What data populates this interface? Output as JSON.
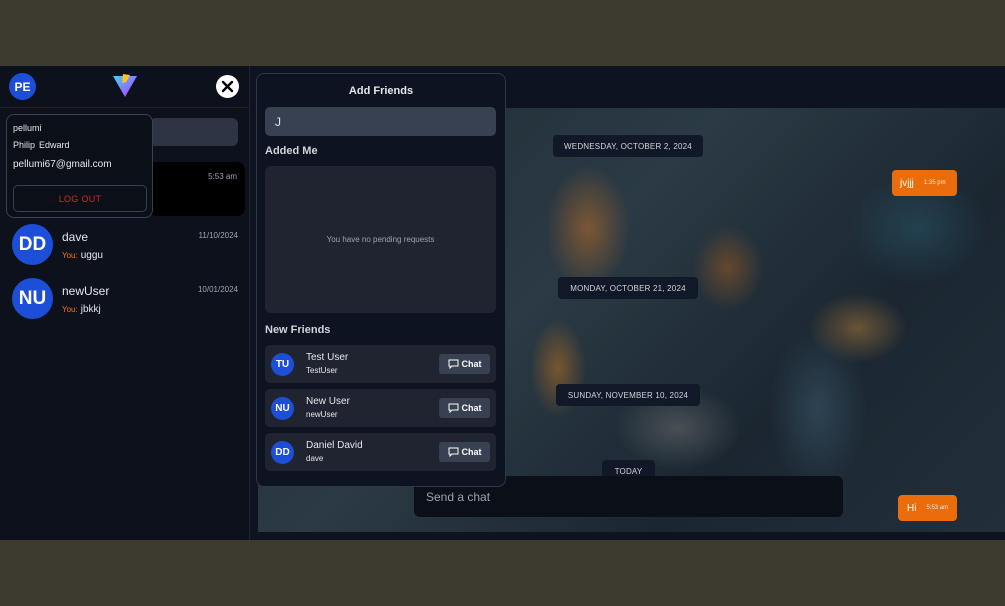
{
  "colors": {
    "accent": "#ea6c0a",
    "avatar": "#1d4ed8",
    "logout": "#dc2626"
  },
  "sidebar": {
    "me_initials": "PE",
    "active_chat_time": "5:53 am",
    "conversations": [
      {
        "initials": "DD",
        "name": "dave",
        "date": "11/10/2024",
        "you_label": "You:",
        "preview": "uggu"
      },
      {
        "initials": "NU",
        "name": "newUser",
        "date": "10/01/2024",
        "you_label": "You:",
        "preview": "jbkkj"
      }
    ]
  },
  "profile": {
    "username": "pellumi",
    "first_name": "Philip",
    "last_name": "Edward",
    "email": "pellumi67@gmail.com",
    "logout_label": "LOG OUT"
  },
  "chat": {
    "dates": [
      "WEDNESDAY, OCTOBER 2, 2024",
      "MONDAY, OCTOBER 21, 2024",
      "SUNDAY, NOVEMBER 10, 2024",
      "TODAY"
    ],
    "messages": [
      {
        "text": "jvjjj",
        "time": "1:35 pm"
      },
      {
        "text": "Hi",
        "time": "5:53 am"
      }
    ],
    "input_placeholder": "Send a chat"
  },
  "add_friends": {
    "title": "Add Friends",
    "search_value": "J",
    "added_me_label": "Added Me",
    "pending_text": "You have no pending requests",
    "new_friends_label": "New Friends",
    "chat_button_label": "Chat",
    "friends": [
      {
        "initials": "TU",
        "name": "Test User",
        "username": "TestUser"
      },
      {
        "initials": "NU",
        "name": "New User",
        "username": "newUser"
      },
      {
        "initials": "DD",
        "name": "Daniel David",
        "username": "dave"
      }
    ]
  }
}
